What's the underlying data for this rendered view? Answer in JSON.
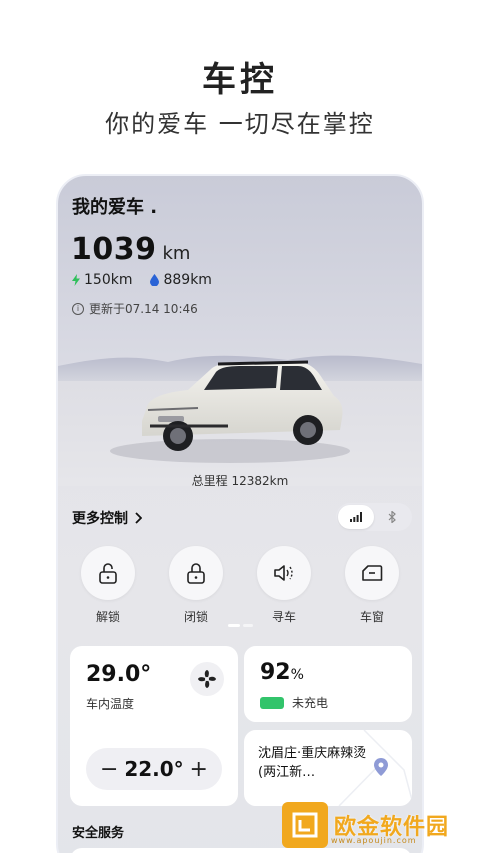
{
  "hero": {
    "title": "车控",
    "subtitle": "你的爱车 一切尽在掌控"
  },
  "car": {
    "title": "我的爱车",
    "range_value": "1039",
    "range_unit": "km",
    "electric_range": "150km",
    "fuel_range": "889km",
    "updated": "更新于07.14 10:46",
    "total_mileage": "总里程 12382km"
  },
  "more_controls": {
    "label": "更多控制"
  },
  "connection_toggle": {
    "active": "cellular",
    "options": [
      "signal-icon",
      "bluetooth-icon"
    ]
  },
  "controls": [
    {
      "label": "解锁",
      "icon": "unlock-icon"
    },
    {
      "label": "闭锁",
      "icon": "lock-icon"
    },
    {
      "label": "寻车",
      "icon": "horn-icon"
    },
    {
      "label": "车窗",
      "icon": "window-icon"
    }
  ],
  "climate": {
    "interior_temp": "29.0°",
    "interior_label": "车内温度",
    "set_temp": "22.0°",
    "minus": "−",
    "plus": "+"
  },
  "battery": {
    "percent": "92",
    "unit": "%",
    "status": "未充电",
    "level": 0.92,
    "color": "#32c46b"
  },
  "location": {
    "text": "沈眉庄·重庆麻辣烫(两江新…"
  },
  "sections": {
    "safety": "安全服务"
  },
  "watermark": {
    "text": "欧金软件园",
    "url": "www.apoujin.com"
  }
}
